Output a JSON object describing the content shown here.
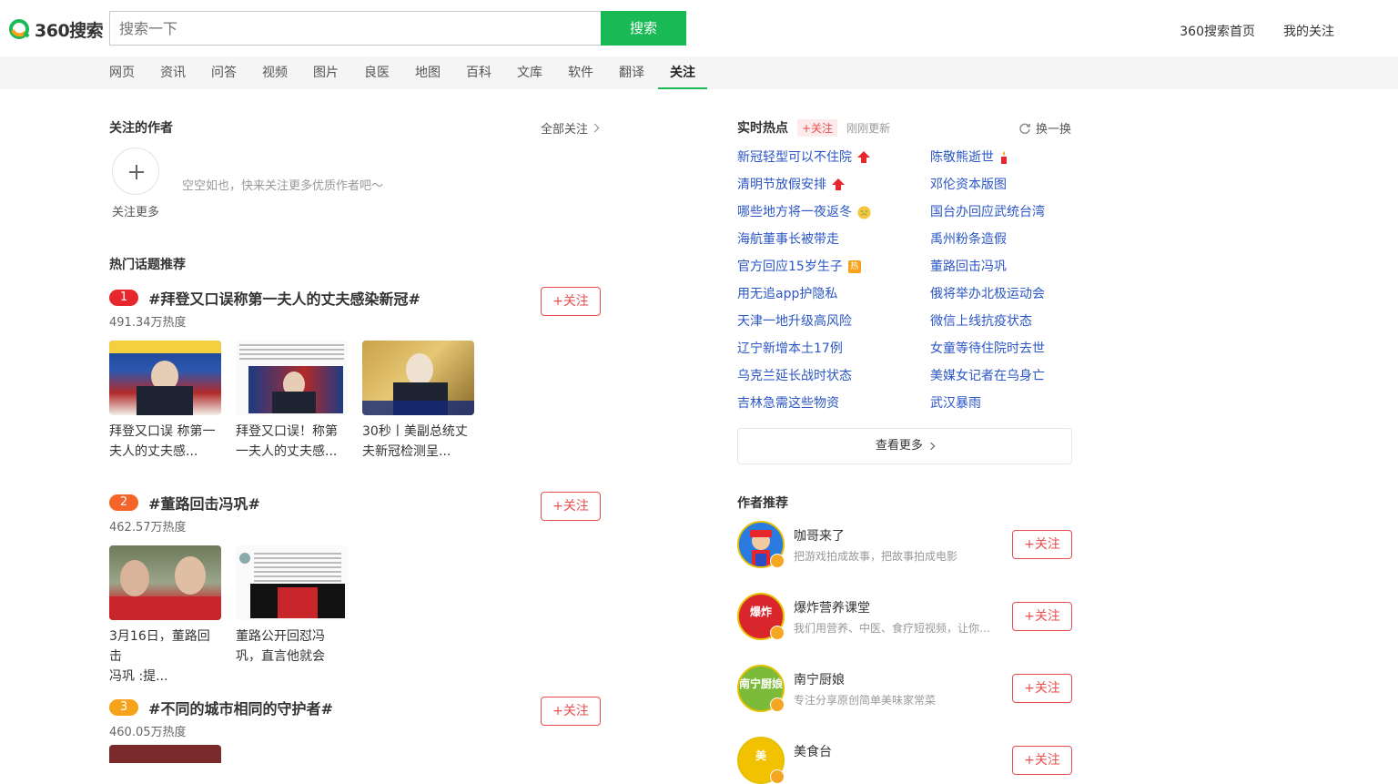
{
  "header": {
    "brand": "360搜索",
    "search_placeholder": "搜索一下",
    "search_button": "搜索",
    "links": [
      "360搜索首页",
      "我的关注"
    ]
  },
  "nav": {
    "items": [
      "网页",
      "资讯",
      "问答",
      "视频",
      "图片",
      "良医",
      "地图",
      "百科",
      "文库",
      "软件",
      "翻译",
      "关注"
    ],
    "active": "关注"
  },
  "followed_authors": {
    "title": "关注的作者",
    "all_link": "全部关注",
    "add_label": "关注更多",
    "empty_text": "空空如也，快来关注更多优质作者吧～"
  },
  "hot_topics": {
    "title": "热门话题推荐",
    "follow_label": "+关注",
    "items": [
      {
        "rank": "1",
        "rank_color": "#e8262d",
        "title": "#拜登又口误称第一夫人的丈夫感染新冠#",
        "heat": "491.34万热度",
        "thumbs": [
          {
            "caption_1": "拜登又口误 称第一",
            "caption_2": "夫人的丈夫感..."
          },
          {
            "caption_1": "拜登又口误！称第",
            "caption_2": "一夫人的丈夫感..."
          },
          {
            "caption_1": "30秒丨美副总统丈",
            "caption_2": "夫新冠检测呈..."
          }
        ]
      },
      {
        "rank": "2",
        "rank_color": "#f5642a",
        "title": "#董路回击冯巩#",
        "heat": "462.57万热度",
        "thumbs": [
          {
            "caption_1": "3月16日，董路回击",
            "caption_2": "冯巩 :提..."
          },
          {
            "caption_1": "董路公开回怼冯",
            "caption_2": "巩，直言他就会"
          }
        ]
      },
      {
        "rank": "3",
        "rank_color": "#f7a21b",
        "title": "#不同的城市相同的守护者#",
        "heat": "460.05万热度",
        "thumbs": []
      }
    ]
  },
  "realtime_hot": {
    "title": "实时热点",
    "follow_label": "+关注",
    "updated": "刚刚更新",
    "refresh": "换一换",
    "view_more": "查看更多",
    "left": [
      {
        "text": "新冠轻型可以不住院",
        "badge": "up"
      },
      {
        "text": "清明节放假安排",
        "badge": "up"
      },
      {
        "text": "哪些地方将一夜返冬",
        "badge": "emoji"
      },
      {
        "text": "海航董事长被带走",
        "badge": ""
      },
      {
        "text": "官方回应15岁生子",
        "badge": "hot",
        "badge_text": "热"
      },
      {
        "text": "用无追app护隐私",
        "badge": ""
      },
      {
        "text": "天津一地升级高风险",
        "badge": ""
      },
      {
        "text": "辽宁新增本土17例",
        "badge": ""
      },
      {
        "text": "乌克兰延长战时状态",
        "badge": ""
      },
      {
        "text": "吉林急需这些物资",
        "badge": ""
      }
    ],
    "right": [
      {
        "text": "陈敬熊逝世",
        "badge": "candle"
      },
      {
        "text": "邓伦资本版图",
        "badge": ""
      },
      {
        "text": "国台办回应武统台湾",
        "badge": ""
      },
      {
        "text": "禹州粉条造假",
        "badge": ""
      },
      {
        "text": "董路回击冯巩",
        "badge": ""
      },
      {
        "text": "俄将举办北极运动会",
        "badge": ""
      },
      {
        "text": "微信上线抗疫状态",
        "badge": ""
      },
      {
        "text": "女童等待住院时去世",
        "badge": ""
      },
      {
        "text": "美媒女记者在乌身亡",
        "badge": ""
      },
      {
        "text": "武汉暴雨",
        "badge": ""
      }
    ]
  },
  "author_recommend": {
    "title": "作者推荐",
    "follow_label": "+关注",
    "items": [
      {
        "name": "咖哥来了",
        "desc": "把游戏拍成故事，把故事拍成电影",
        "avatar_bg": "#2a7be0"
      },
      {
        "name": "爆炸营养课堂",
        "desc": "我们用营养、中医、食疗短视频，让你…",
        "avatar_bg": "#d9262c",
        "avatar_text": "爆炸"
      },
      {
        "name": "南宁厨娘",
        "desc": "专注分享原创简单美味家常菜",
        "avatar_bg": "#7cbb3a",
        "avatar_text": "南宁厨娘"
      },
      {
        "name": "美食台",
        "desc": "",
        "avatar_bg": "#f2c200",
        "avatar_text": "美"
      }
    ]
  }
}
